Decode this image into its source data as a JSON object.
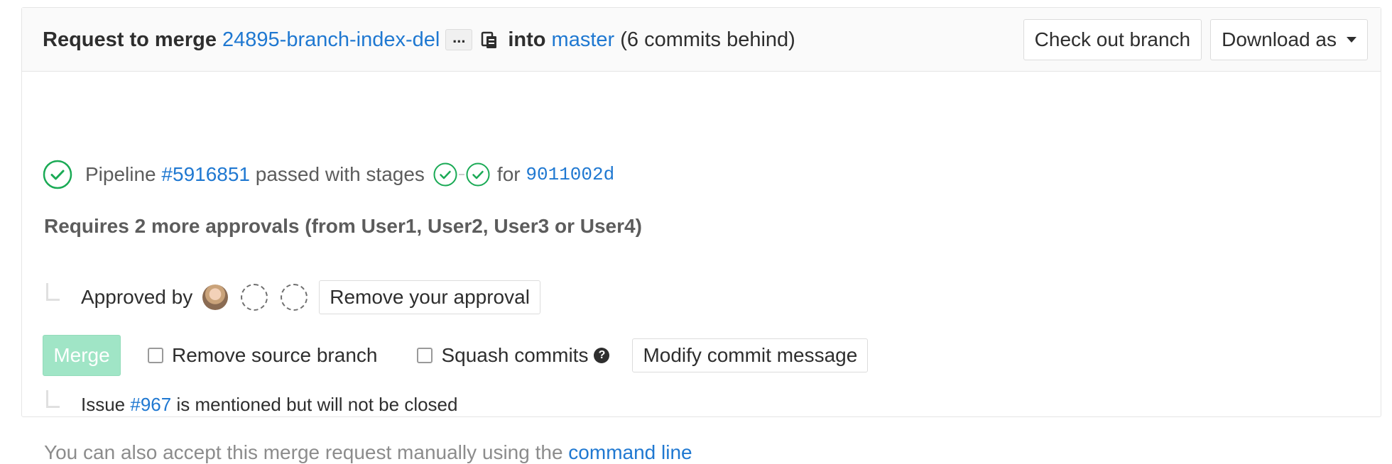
{
  "header": {
    "request_label": "Request to merge",
    "source_branch": "24895-branch-index-del",
    "ellipsis": "...",
    "into_label": "into",
    "target_branch": "master",
    "behind_text": "(6 commits behind)",
    "checkout_button": "Check out branch",
    "download_button": "Download as"
  },
  "pipeline": {
    "prefix": "Pipeline",
    "id": "#5916851",
    "status_text": "passed with stages",
    "for_label": "for",
    "commit": "9011002d",
    "status_color": "#1aaa55"
  },
  "approvals": {
    "title": "Requires 2 more approvals (from User1, User2, User3 or User4)",
    "approved_by_label": "Approved by",
    "remove_button": "Remove your approval"
  },
  "merge": {
    "merge_button": "Merge",
    "remove_source_label": "Remove source branch",
    "squash_label": "Squash commits",
    "modify_button": "Modify commit message"
  },
  "issue": {
    "prefix": "Issue",
    "number": "#967",
    "suffix": "is mentioned but will not be closed"
  },
  "manual": {
    "text": "You can also accept this merge request manually using the",
    "link": "command line"
  },
  "colors": {
    "link": "#1f78d1",
    "merge_disabled": "#a0e5c6"
  }
}
